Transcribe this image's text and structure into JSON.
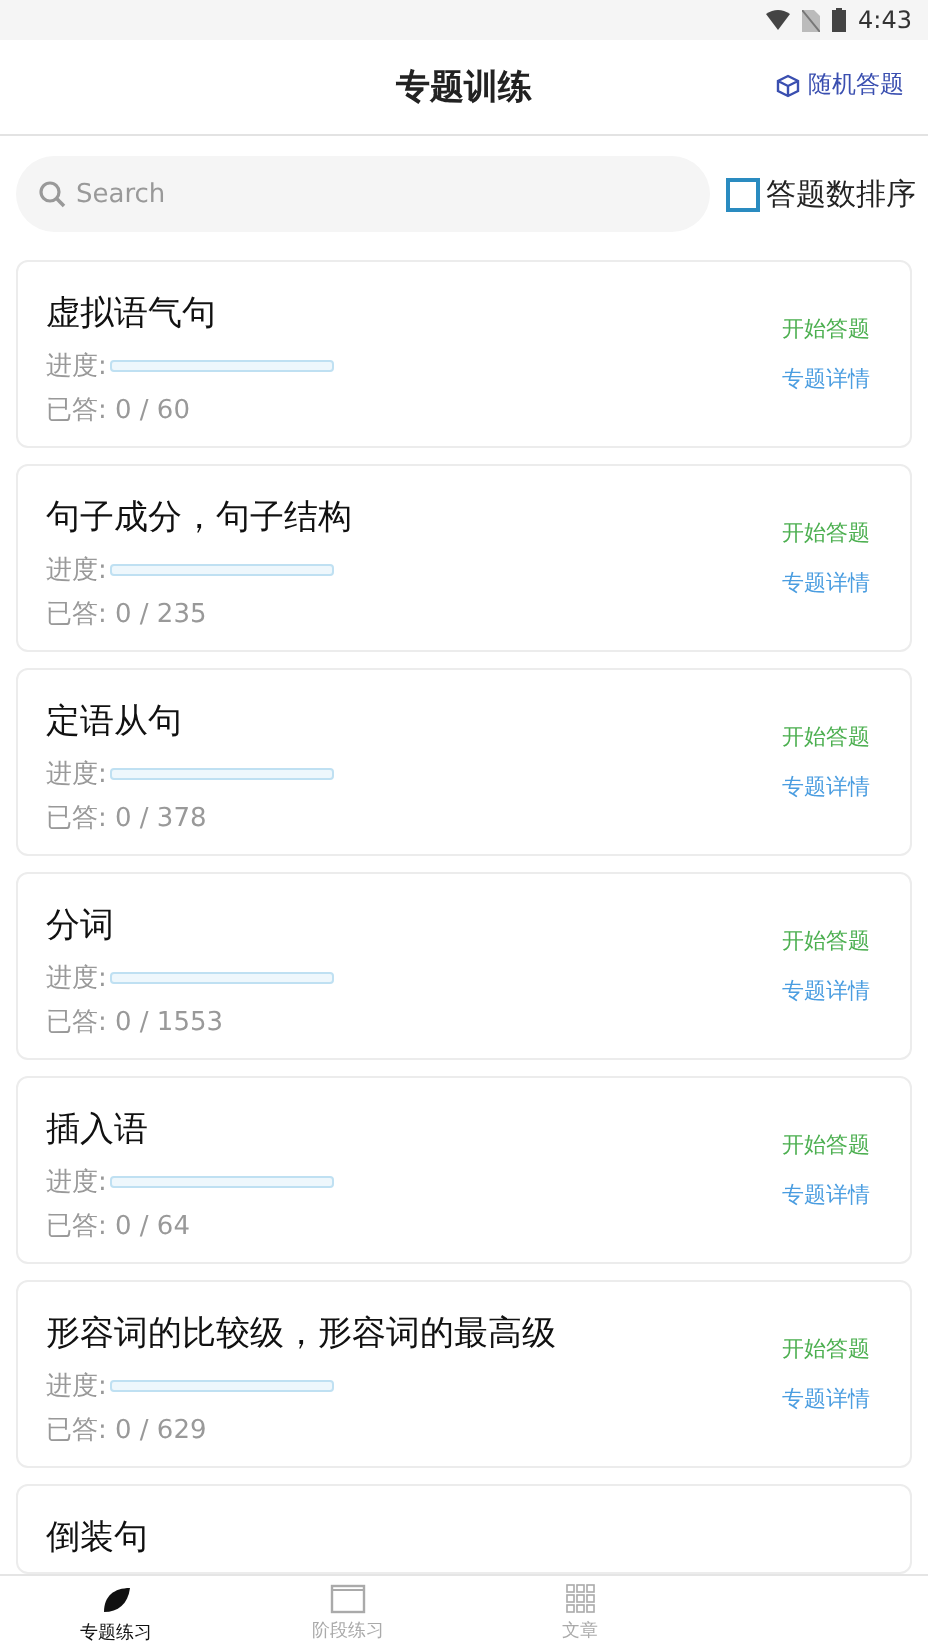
{
  "status_bar": {
    "time": "4:43"
  },
  "header": {
    "title": "专题训练",
    "action": "随机答题"
  },
  "search": {
    "placeholder": "Search"
  },
  "sort_option": {
    "label": "答题数排序",
    "checked": false
  },
  "topics": [
    {
      "title": "虚拟语气句",
      "progress_label": "进度:",
      "level": 0,
      "answered": "已答: 0 / 60",
      "start": "开始答题",
      "details": "专题详情"
    },
    {
      "title": "句子成分，句子结构",
      "progress_label": "进度:",
      "level": 0,
      "answered": "已答: 0 / 235",
      "start": "开始答题",
      "details": "专题详情"
    },
    {
      "title": "定语从句",
      "progress_label": "进度:",
      "level": 0,
      "answered": "已答: 0 / 378",
      "start": "开始答题",
      "details": "专题详情"
    },
    {
      "title": "分词",
      "progress_label": "进度:",
      "level": 0,
      "answered": "已答: 0 / 1553",
      "start": "开始答题",
      "details": "专题详情"
    },
    {
      "title": "插入语",
      "progress_label": "进度:",
      "level": 0,
      "answered": "已答: 0 / 64",
      "start": "开始答题",
      "details": "专题详情"
    },
    {
      "title": "形容词的比较级，形容词的最高级",
      "progress_label": "进度:",
      "level": 0,
      "answered": "已答: 0 / 629",
      "start": "开始答题",
      "details": "专题详情"
    },
    {
      "title": "倒装句"
    }
  ],
  "bottom_nav": [
    {
      "label": "专题练习",
      "kind": "leaf",
      "selected": true
    },
    {
      "label": "阶段练习",
      "kind": "window",
      "selected": false
    },
    {
      "label": "文章",
      "kind": "grid",
      "selected": false
    }
  ]
}
